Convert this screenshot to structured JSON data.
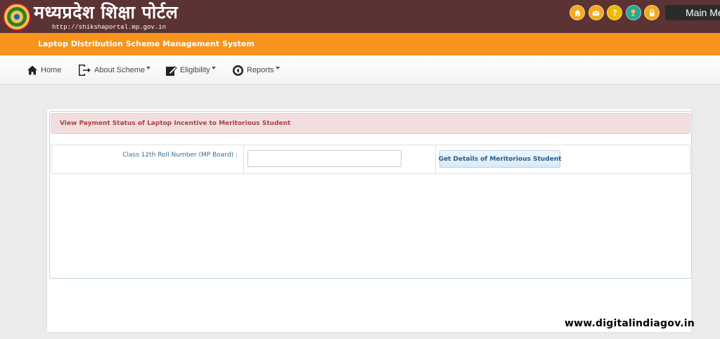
{
  "header": {
    "portal_title": "मध्यप्रदेश शिक्षा पोर्टल",
    "portal_url": "http://shikshaportal.mp.gov.in",
    "icons": [
      "home-icon",
      "mail-icon",
      "help-icon",
      "trophy-icon",
      "lock-icon"
    ],
    "main_menu_label": "Main Me"
  },
  "system_bar": {
    "title": "Laptop Distribution Scheme Management System"
  },
  "nav": {
    "items": [
      {
        "label": "Home",
        "icon": "home-icon"
      },
      {
        "label": "About Scheme",
        "icon": "document-export-icon",
        "dropdown": true
      },
      {
        "label": "Eligibility",
        "icon": "edit-icon",
        "dropdown": true
      },
      {
        "label": "Reports",
        "icon": "report-icon",
        "dropdown": true
      }
    ]
  },
  "form": {
    "heading": "View Payment Status of Laptop Incentive to Meritorious Student",
    "roll_label": "Class 12th Roll Number (MP Board) :",
    "roll_value": "",
    "submit_label": "Get Details of Meritorious Student"
  },
  "watermark": "www.digitalindiagov.in",
  "colors": {
    "header_bg": "#5b3332",
    "accent_orange": "#f7941d",
    "alert_bg": "#f2dede",
    "alert_text": "#a94442",
    "label_blue": "#31708f"
  }
}
